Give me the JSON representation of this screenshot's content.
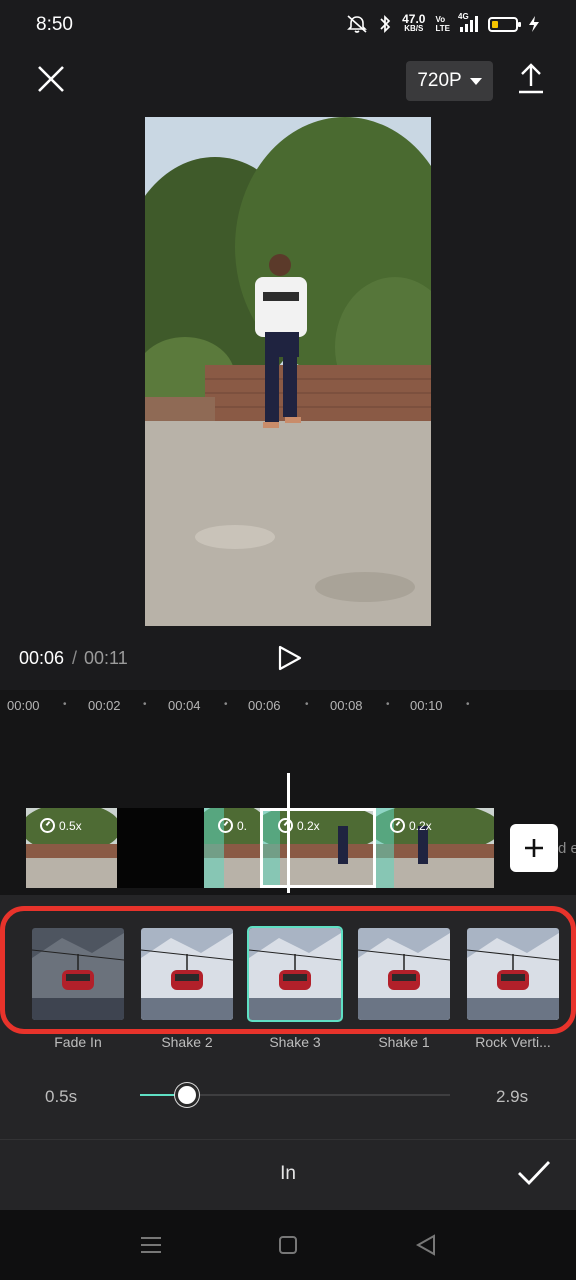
{
  "status_bar": {
    "time": "8:50",
    "net_speed_value": "47.0",
    "net_speed_unit": "KB/S",
    "volte_top": "Vo",
    "volte_bottom": "LTE",
    "network_type": "4G",
    "icons": [
      "mute-icon",
      "bluetooth-icon",
      "signal-icon",
      "battery-icon",
      "charging-icon"
    ]
  },
  "toolbar": {
    "resolution_label": "720P",
    "close_icon": "close-icon",
    "export_icon": "upload-icon"
  },
  "playback": {
    "current_time": "00:06",
    "separator": "/",
    "total_time": "00:11",
    "play_icon": "play-icon"
  },
  "timeline": {
    "ruler_labels": [
      "00:00",
      "00:02",
      "00:04",
      "00:06",
      "00:08",
      "00:10"
    ],
    "clips": [
      {
        "speed": "0.5x"
      },
      {
        "speed": "0."
      },
      {
        "speed": "0.2x"
      },
      {
        "speed": "0.2x"
      }
    ],
    "trailing_text": "d e"
  },
  "animation_panel": {
    "items": [
      {
        "label": "Fade In"
      },
      {
        "label": "Shake 2"
      },
      {
        "label": "Shake 3"
      },
      {
        "label": "Shake 1"
      },
      {
        "label": "Rock Verti..."
      }
    ],
    "selected_index": 2,
    "duration_min": "0.5s",
    "duration_max": "2.9s",
    "slider_value_fraction": 0.15,
    "title": "In",
    "accent_color": "#5fe0c4",
    "highlight_color": "#e8332b"
  },
  "nav_bar": {
    "icons": [
      "menu-icon",
      "home-icon",
      "back-icon"
    ]
  }
}
